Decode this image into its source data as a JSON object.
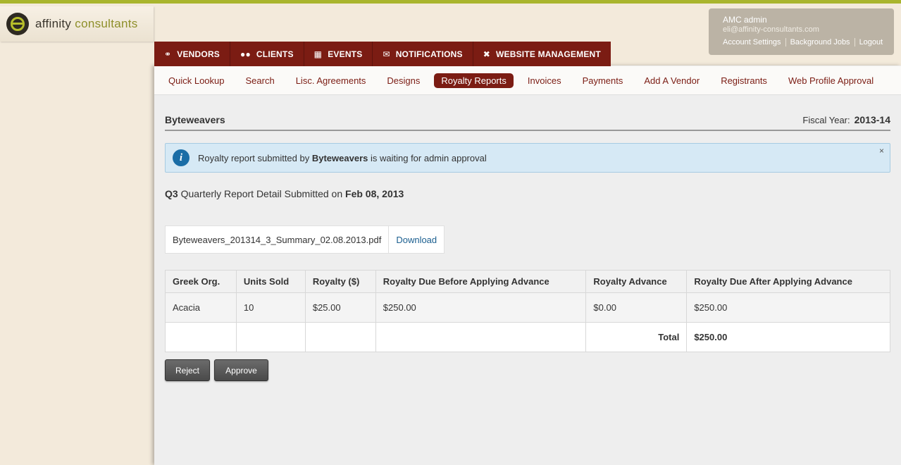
{
  "brand": {
    "word1": "affinity",
    "word2": "consultants"
  },
  "user": {
    "name": "AMC admin",
    "email": "eli@affinity-consultants.com",
    "links": [
      "Account Settings",
      "Background Jobs",
      "Logout"
    ]
  },
  "topnav": [
    {
      "label": "VENDORS",
      "icon": "link-icon"
    },
    {
      "label": "CLIENTS",
      "icon": "users-icon"
    },
    {
      "label": "EVENTS",
      "icon": "calendar-icon"
    },
    {
      "label": "NOTIFICATIONS",
      "icon": "envelope-icon"
    },
    {
      "label": "WEBSITE MANAGEMENT",
      "icon": "tools-icon"
    }
  ],
  "subnav": {
    "tabs": [
      "Quick Lookup",
      "Search",
      "Lisc. Agreements",
      "Designs",
      "Royalty Reports",
      "Invoices",
      "Payments",
      "Add A Vendor",
      "Registrants",
      "Web Profile Approval"
    ],
    "active": "Royalty Reports"
  },
  "page": {
    "vendor": "Byteweavers",
    "fiscal_label": "Fiscal Year:",
    "fiscal_value": "2013-14"
  },
  "alert": {
    "prefix": "Royalty report submitted by",
    "vendor": "Byteweavers",
    "suffix": "is waiting for admin approval",
    "close": "×"
  },
  "report": {
    "quarter": "Q3",
    "middle": "Quarterly Report Detail Submitted on",
    "date": "Feb 08, 2013"
  },
  "file": {
    "name": "Byteweavers_201314_3_Summary_02.08.2013.pdf",
    "download": "Download"
  },
  "table": {
    "headers": [
      "Greek Org.",
      "Units Sold",
      "Royalty ($)",
      "Royalty Due Before Applying Advance",
      "Royalty Advance",
      "Royalty Due After Applying Advance"
    ],
    "rows": [
      [
        "Acacia",
        "10",
        "$25.00",
        "$250.00",
        "$0.00",
        "$250.00"
      ]
    ],
    "total_label": "Total",
    "total_value": "$250.00"
  },
  "buttons": {
    "reject": "Reject",
    "approve": "Approve"
  }
}
